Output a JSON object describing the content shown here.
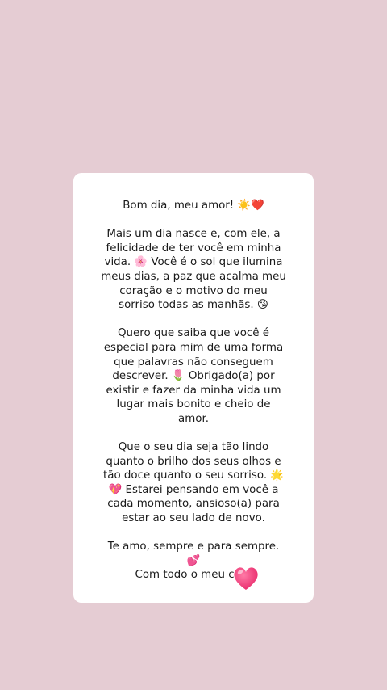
{
  "message": {
    "greeting": "Bom dia, meu amor! ☀️❤️",
    "paragraph1": "Mais um dia nasce e, com ele, a\nfelicidade de ter você em minha\nvida. 🌸 Você é o sol que ilumina\nmeus dias, a paz que acalma meu\ncoração e o motivo do meu\nsorriso todas as manhãs. 😘",
    "paragraph2": "Quero que saiba que você é\nespecial para mim de uma forma\nque palavras não conseguem\ndescrever. 🌷 Obrigado(a) por\nexistir e fazer da minha vida um\nlugar mais bonito e cheio de\namor.",
    "paragraph3": "Que o seu dia seja tão lindo\nquanto o brilho dos seus olhos e\ntão doce quanto o seu sorriso. 🌟\n💖 Estarei pensando em você a\ncada momento, ansioso(a) para\nestar ao seu lado de novo.",
    "closing": "Te amo, sempre e para sempre.",
    "closing_emoji": "💕",
    "signoff": "Com todo o meu cora"
  },
  "sticker": {
    "icon": "heart-icon",
    "color": "#e8286a"
  }
}
